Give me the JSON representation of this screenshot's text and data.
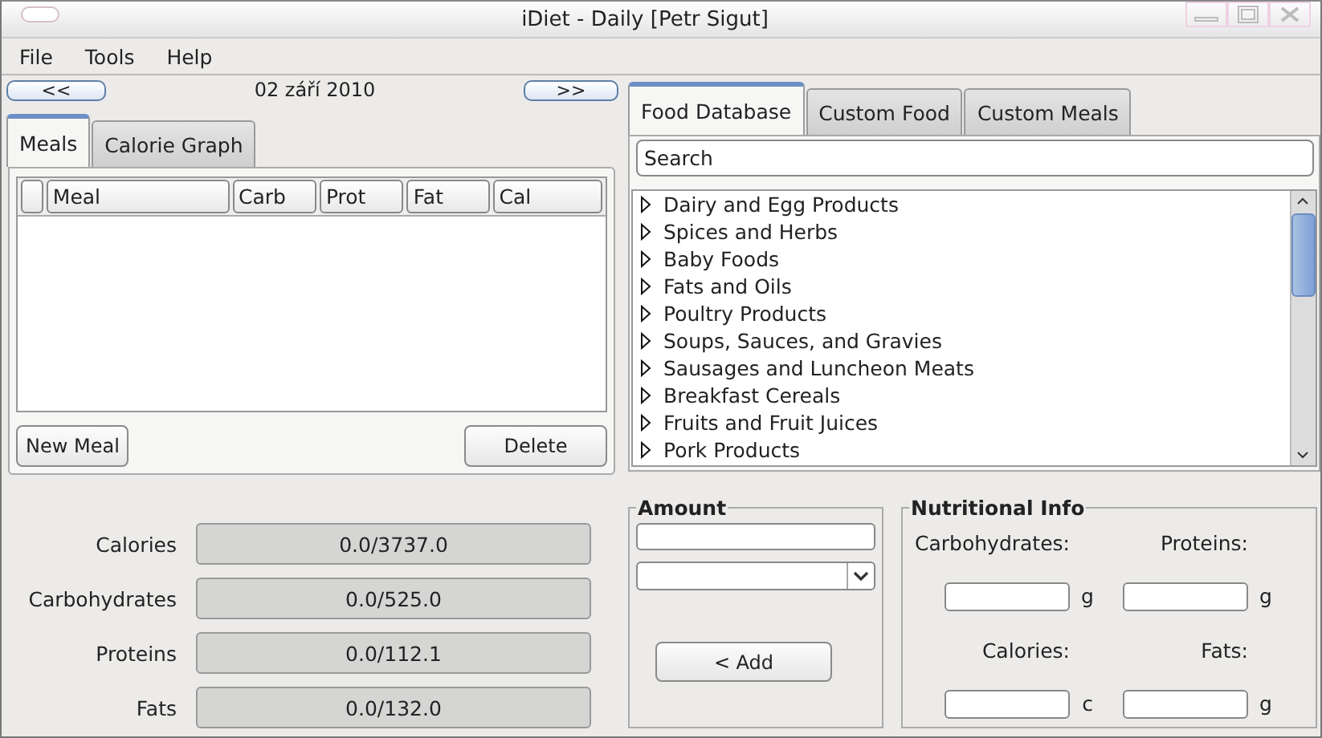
{
  "window": {
    "title": "iDiet - Daily [Petr Sigut]"
  },
  "menu": [
    "File",
    "Tools",
    "Help"
  ],
  "date_nav": {
    "prev": "<<",
    "date": "02 září 2010",
    "next": ">>"
  },
  "left_tabs": [
    {
      "label": "Meals",
      "selected": true
    },
    {
      "label": "Calorie Graph",
      "selected": false
    }
  ],
  "meals_table": {
    "columns": [
      "",
      "Meal",
      "Carb",
      "Prot",
      "Fat",
      "Cal"
    ]
  },
  "meal_buttons": [
    "New Meal",
    "Delete"
  ],
  "totals": [
    {
      "label": "Calories",
      "reading": "0.0/3737.0",
      "level": 0
    },
    {
      "label": "Carbohydrates",
      "reading": "0.0/525.0",
      "level": 0
    },
    {
      "label": "Proteins",
      "reading": "0.0/112.1",
      "level": 0
    },
    {
      "label": "Fats",
      "reading": "0.0/132.0",
      "level": 0
    }
  ],
  "right_tabs": [
    {
      "label": "Food Database",
      "selected": true
    },
    {
      "label": "Custom Food",
      "selected": false
    },
    {
      "label": "Custom Meals",
      "selected": false
    }
  ],
  "search": {
    "value": "Search"
  },
  "food_tree": [
    {
      "label": "Dairy and Egg Products",
      "expanded": false
    },
    {
      "label": "Spices and Herbs",
      "expanded": false
    },
    {
      "label": "Baby Foods",
      "expanded": false
    },
    {
      "label": "Fats and Oils",
      "expanded": false
    },
    {
      "label": "Poultry Products",
      "expanded": false
    },
    {
      "label": "Soups, Sauces, and Gravies",
      "expanded": false
    },
    {
      "label": "Sausages and Luncheon Meats",
      "expanded": false
    },
    {
      "label": "Breakfast Cereals",
      "expanded": false
    },
    {
      "label": "Fruits and Fruit Juices",
      "expanded": false
    },
    {
      "label": "Pork Products",
      "expanded": false
    }
  ],
  "amount": {
    "title": "Amount",
    "add_button": "< Add"
  },
  "nutritional_info": {
    "title": "Nutritional Info",
    "fields": [
      {
        "label": "Carbohydrates:",
        "unit": "g"
      },
      {
        "label": "Proteins:",
        "unit": "g"
      },
      {
        "label": "Calories:",
        "unit": "c"
      },
      {
        "label": "Fats:",
        "unit": "g"
      }
    ]
  }
}
